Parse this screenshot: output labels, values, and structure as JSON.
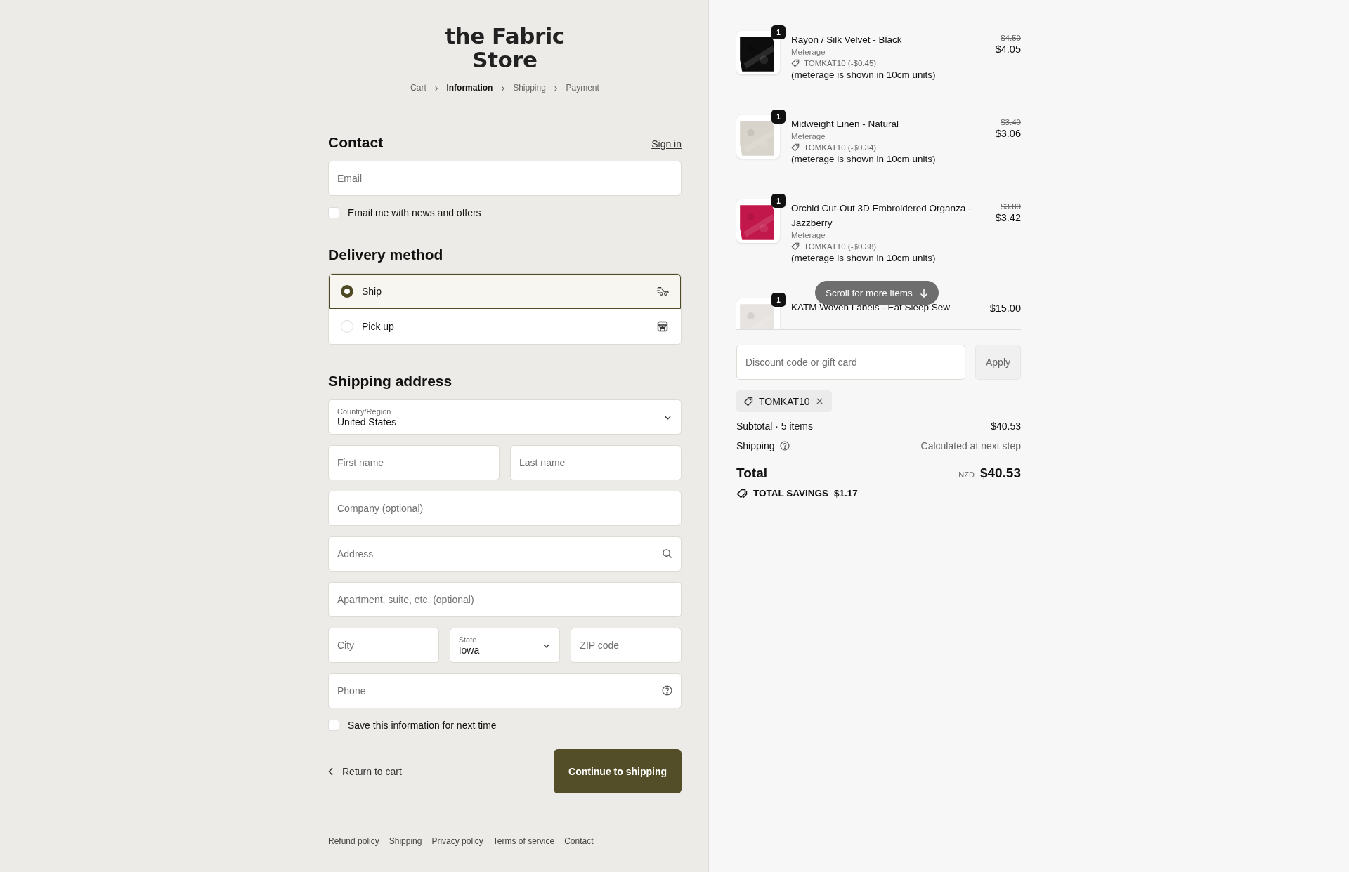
{
  "logo": {
    "line1": "the Fabric",
    "line2": "Store"
  },
  "breadcrumbs": [
    {
      "label": "Cart",
      "selected": false,
      "separator": "›"
    },
    {
      "label": "Information",
      "selected": true,
      "separator": "›"
    },
    {
      "label": "Shipping",
      "selected": false,
      "separator": "›"
    },
    {
      "label": "Payment",
      "selected": false
    }
  ],
  "contact": {
    "heading": "Contact",
    "sign_in": "Sign in",
    "email": {
      "placeholder": "Email"
    },
    "news_checkbox": {
      "label": "Email me with news and offers",
      "checked": false
    }
  },
  "delivery": {
    "heading": "Delivery method",
    "options": [
      {
        "label": "Ship",
        "selected": true,
        "kind": "truck"
      },
      {
        "label": "Pick up",
        "selected": false,
        "kind": "store"
      }
    ]
  },
  "shipping_address": {
    "heading": "Shipping address",
    "rows": [
      [
        {
          "kind": "select",
          "label": "Country/Region",
          "value": "United States"
        }
      ],
      [
        {
          "kind": "text",
          "placeholder": "First name"
        },
        {
          "kind": "text",
          "placeholder": "Last name"
        }
      ],
      [
        {
          "kind": "text",
          "placeholder": "Company (optional)"
        }
      ],
      [
        {
          "kind": "search",
          "placeholder": "Address"
        }
      ],
      [
        {
          "kind": "text",
          "placeholder": "Apartment, suite, etc. (optional)"
        }
      ],
      [
        {
          "kind": "text",
          "placeholder": "City"
        },
        {
          "kind": "select",
          "label": "State",
          "value": "Iowa"
        },
        {
          "kind": "text",
          "placeholder": "ZIP code"
        }
      ],
      [
        {
          "kind": "help",
          "placeholder": "Phone"
        }
      ]
    ],
    "save_checkbox": {
      "label": "Save this information for next time",
      "checked": false
    }
  },
  "actions": {
    "back_link": "Return to cart",
    "continue_button": "Continue to shipping"
  },
  "footer_links": [
    "Refund policy",
    "Shipping",
    "Privacy policy",
    "Terms of service",
    "Contact"
  ],
  "order": {
    "items": [
      {
        "name": "Rayon / Silk Velvet - Black",
        "quantity": "1",
        "variant": "Meterage",
        "discount": "TOMKAT10 (-$0.45)",
        "note": "(meterage is shown in 10cm units)",
        "original_price": "$4.50",
        "price": "$4.05"
      },
      {
        "name": "Midweight Linen - Natural",
        "quantity": "1",
        "variant": "Meterage",
        "discount": "TOMKAT10 (-$0.34)",
        "note": "(meterage is shown in 10cm units)",
        "original_price": "$3.40",
        "price": "$3.06"
      },
      {
        "name": "Orchid Cut-Out 3D Embroidered Organza - Jazzberry",
        "quantity": "1",
        "variant": "Meterage",
        "discount": "TOMKAT10 (-$0.38)",
        "note": "(meterage is shown in 10cm units)",
        "original_price": "$3.80",
        "price": "$3.42"
      },
      {
        "name": "KATM Woven Labels - Eat Sleep Sew",
        "quantity": "1",
        "price": "$15.00"
      }
    ],
    "scroll_hint": "Scroll for more items",
    "discount_field": {
      "placeholder": "Discount code or gift card"
    },
    "apply_button": "Apply",
    "applied_code": "TOMKAT10",
    "subtotal": {
      "label": "Subtotal · 5 items",
      "value": "$40.53"
    },
    "shipping": {
      "label": "Shipping",
      "value": "Calculated at next step"
    },
    "total": {
      "label": "Total",
      "currency": "NZD",
      "value": "$40.53"
    },
    "savings": {
      "label": "TOTAL SAVINGS",
      "value": "$1.17"
    }
  }
}
